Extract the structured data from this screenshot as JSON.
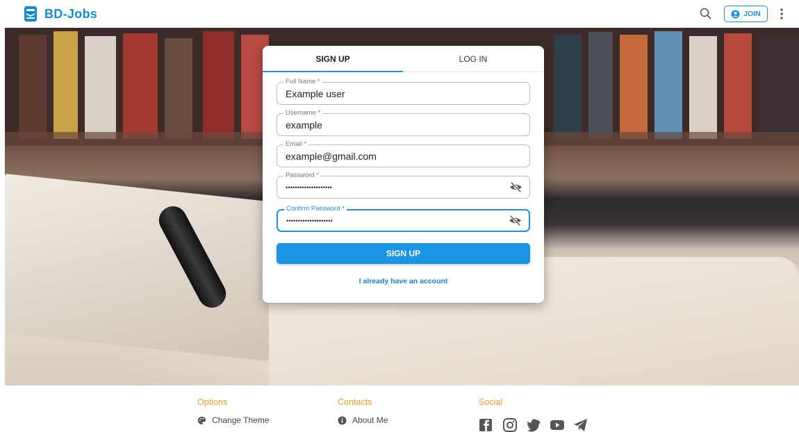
{
  "header": {
    "brand": "BD-Jobs",
    "join_label": "JOIN"
  },
  "auth_card": {
    "tabs": [
      {
        "label": "SIGN UP",
        "active": true
      },
      {
        "label": "LOG IN",
        "active": false
      }
    ],
    "fields": {
      "full_name": {
        "label": "Full Name *",
        "value": "Example user"
      },
      "username": {
        "label": "Username *",
        "value": "example"
      },
      "email": {
        "label": "Email *",
        "value": "example@gmail.com"
      },
      "password": {
        "label": "Password *",
        "value": "••••••••••••••••••••"
      },
      "confirm_password": {
        "label": "Confirm Password *",
        "value": "••••••••••••••••••••"
      }
    },
    "submit_label": "SIGN UP",
    "switch_link": "I already have an account"
  },
  "footer": {
    "options": {
      "title": "Options",
      "item": "Change Theme"
    },
    "contacts": {
      "title": "Contacts",
      "item": "About Me"
    },
    "social": {
      "title": "Social",
      "icons": [
        "facebook-icon",
        "instagram-icon",
        "twitter-icon",
        "youtube-icon",
        "telegram-icon"
      ]
    }
  },
  "colors": {
    "primary": "#1e90e0",
    "brand": "#1589d1",
    "footer_title": "#f09a2c"
  }
}
